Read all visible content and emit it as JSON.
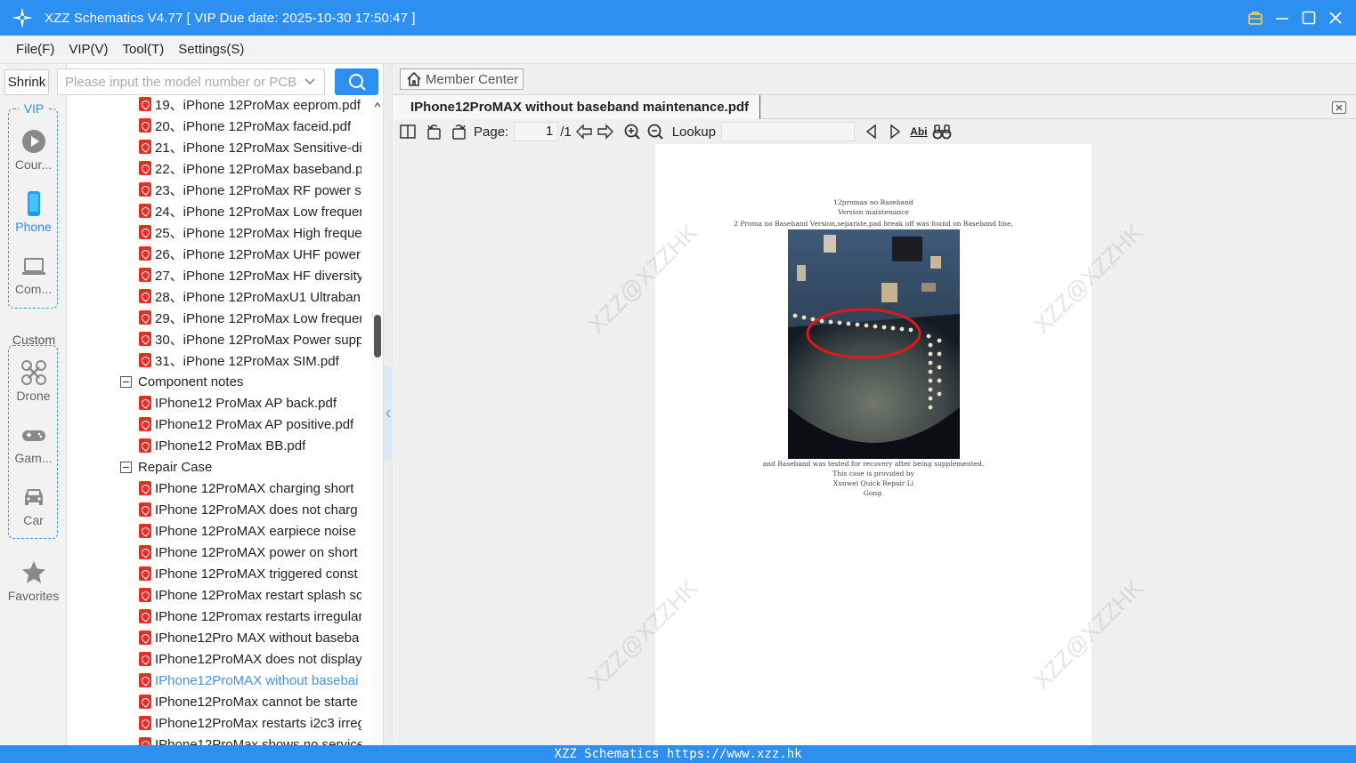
{
  "window": {
    "title": "XZZ Schematics V4.77 [ VIP Due date: 2025-10-30 17:50:47 ]"
  },
  "menu": [
    "File(F)",
    "VIP(V)",
    "Tool(T)",
    "Settings(S)"
  ],
  "sidebar": {
    "shrink_label": "Shrink",
    "vip_group_title": "VIP",
    "custom_group_title": "Custom",
    "items": {
      "courses": "Cour...",
      "phone": "Phone",
      "computer": "Com...",
      "drone": "Drone",
      "game": "Gam...",
      "car": "Car",
      "favorites": "Favorites"
    }
  },
  "search": {
    "placeholder": "Please input the model number or PCB"
  },
  "tree": {
    "numbered_files": [
      "19、iPhone 12ProMax eeprom.pdf",
      "20、iPhone 12ProMax faceid.pdf",
      "21、iPhone 12ProMax Sensitive-di",
      "22、iPhone 12ProMax baseband.p",
      "23、iPhone 12ProMax RF power su",
      "24、iPhone 12ProMax Low frequer",
      "25、iPhone 12ProMax High freque",
      "26、iPhone 12ProMax UHF power",
      "27、iPhone 12ProMax HF diversity",
      "28、iPhone 12ProMaxU1 Ultraban",
      "29、iPhone 12ProMax Low frequer",
      "30、iPhone 12ProMax Power supp",
      "31、iPhone 12ProMax SIM.pdf"
    ],
    "component_notes_label": "Component notes",
    "component_notes": [
      "IPhone12 ProMax AP back.pdf",
      "IPhone12 ProMax AP positive.pdf",
      "IPhone12 ProMax BB.pdf"
    ],
    "repair_case_label": "Repair Case",
    "repair_cases": [
      "IPhone 12ProMAX charging short",
      "IPhone 12ProMAX does not charg",
      "IPhone 12ProMAX earpiece noise",
      "IPhone 12ProMAX power on short",
      "IPhone 12ProMAX triggered const",
      "IPhone 12ProMax restart splash sc",
      "IPhone 12Promax restarts irregular",
      "IPhone12Pro MAX without baseba",
      "IPhone12ProMAX does not display",
      "IPhone12ProMAX without basebai",
      "IPhone12ProMax cannot be starte",
      "IPhone12ProMax restarts i2c3 irreg",
      "IPhone12ProMax shows no service"
    ],
    "selected_repair_case_index": 9
  },
  "viewer": {
    "member_center_label": "Member Center",
    "tab_title": "IPhone12ProMAX without baseband maintenance.pdf",
    "page_label": "Page:",
    "page_current": "1",
    "page_total": "/1",
    "lookup_label": "Lookup",
    "abi_label": "Abi"
  },
  "pdf": {
    "line1": "12promax no Baseband",
    "line2": "Version maintenance",
    "line3": "2 Proma no Baseband Version,separate,pad break off was found on Baseband line,",
    "line4": "and Baseband was tested for recovery after being supplemented.",
    "line5": "This case is provided by",
    "line6": "Xunwei Quick Repair Li",
    "line7": "Gong."
  },
  "watermark_text": "XZZ@XZZHK",
  "footer": "XZZ Schematics https://www.xzz.hk",
  "colors": {
    "primary": "#2d8ff0",
    "pdf_red": "#d9342b",
    "selected_link": "#4a90e2"
  }
}
